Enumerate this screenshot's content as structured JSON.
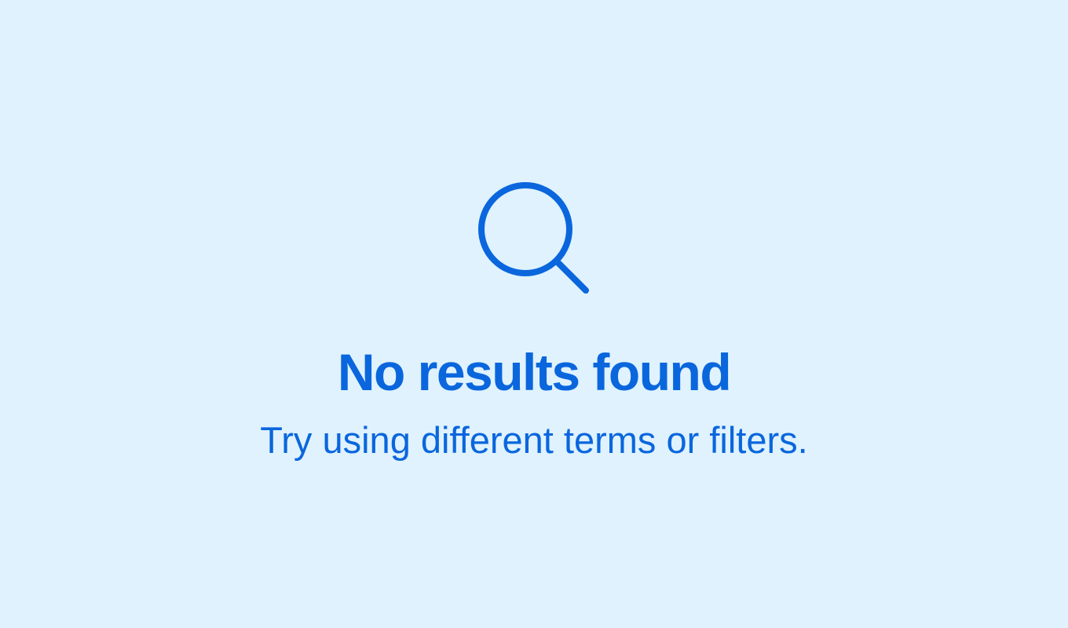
{
  "empty_state": {
    "icon": "search-icon",
    "title": "No results found",
    "message": "Try using different terms or filters."
  },
  "colors": {
    "background": "#dff2fe",
    "accent": "#0a66dd"
  }
}
